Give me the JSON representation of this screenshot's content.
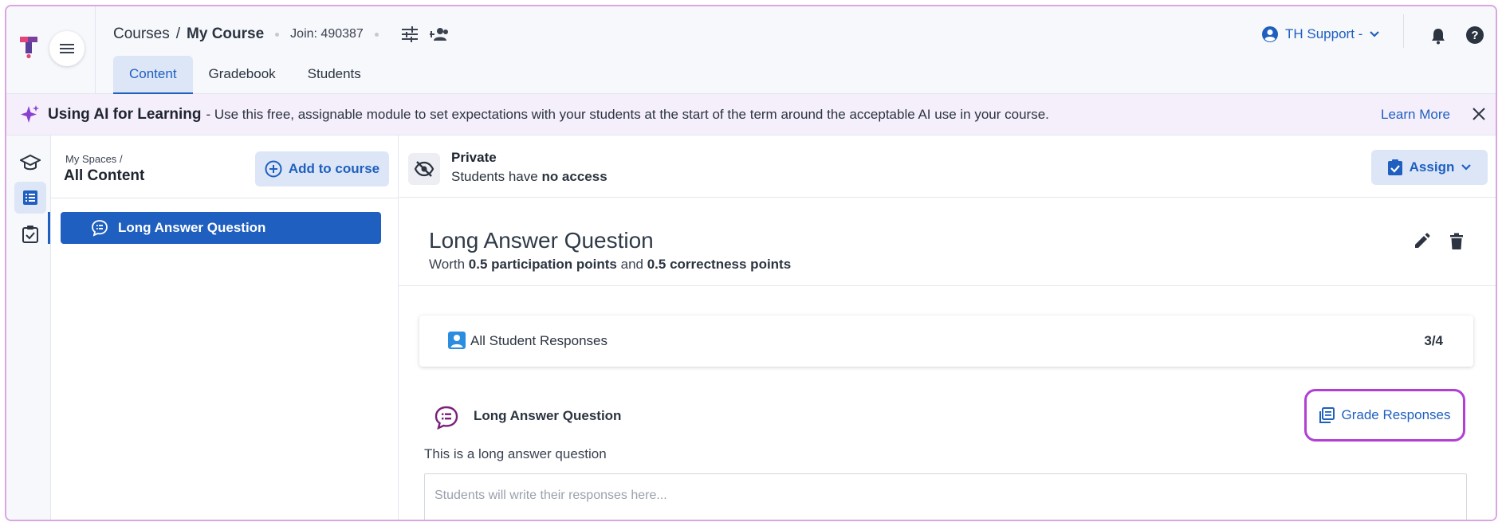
{
  "header": {
    "breadcrumb_root": "Courses",
    "breadcrumb_sep": "/",
    "breadcrumb_current": "My Course",
    "join_code": "Join: 490387",
    "tabs": [
      {
        "label": "Content",
        "active": true
      },
      {
        "label": "Gradebook",
        "active": false
      },
      {
        "label": "Students",
        "active": false
      }
    ],
    "user_label": "TH Support -",
    "icons": [
      "menu-icon",
      "settings-sliders-icon",
      "add-person-icon",
      "user-circle-icon",
      "chevron-down-icon",
      "bell-icon",
      "help-icon"
    ]
  },
  "banner": {
    "title": "Using AI for Learning",
    "text": "- Use this free, assignable module to set expectations with your students at the start of the term around the acceptable AI use in your course.",
    "learn_more": "Learn More",
    "icons": [
      "sparkle-icon",
      "close-icon"
    ]
  },
  "rail": {
    "icons": [
      "graduation-cap-icon",
      "list-icon",
      "checklist-icon"
    ]
  },
  "panel": {
    "breadcrumb": "My Spaces",
    "breadcrumb_sep": "/",
    "title": "All Content",
    "add_button": "Add to course",
    "items": [
      {
        "label": "Long Answer Question",
        "selected": true
      }
    ]
  },
  "main": {
    "privacy_title": "Private",
    "privacy_prefix": "Students have",
    "privacy_bold": "no access",
    "assign_button": "Assign",
    "question_title": "Long Answer Question",
    "worth_prefix": "Worth",
    "participation": "0.5 participation points",
    "worth_and": "and",
    "correctness": "0.5 correctness points",
    "responses_label": "All Student Responses",
    "responses_count": "3/4",
    "question_type_label": "Long Answer Question",
    "grade_button": "Grade Responses",
    "question_text": "This is a long answer question",
    "answer_placeholder": "Students will write their responses here...",
    "accent_color": "#1f5fbf",
    "highlight_color": "#b13fd6"
  }
}
